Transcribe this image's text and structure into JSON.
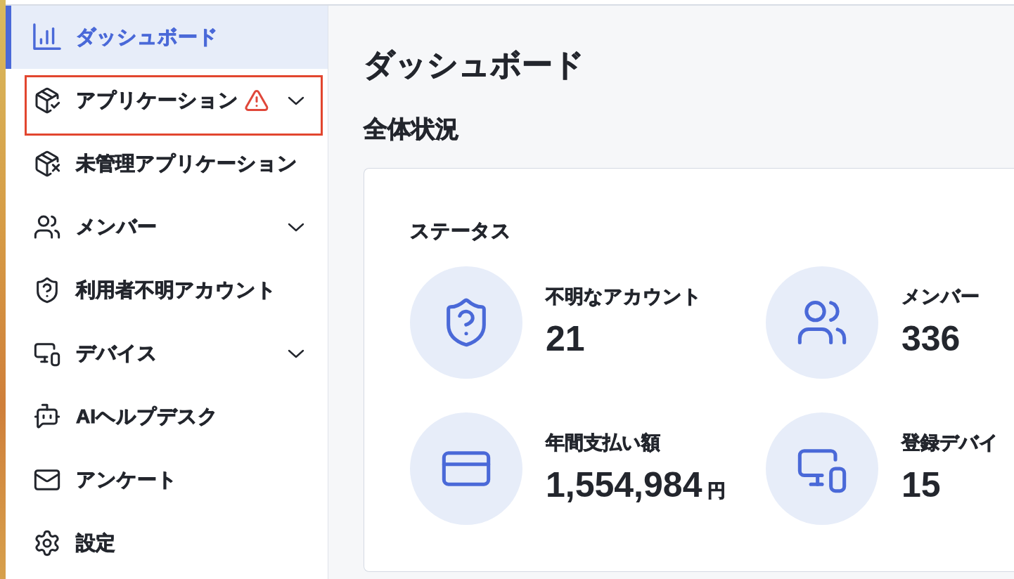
{
  "sidebar": {
    "items": [
      {
        "label": "ダッシュボード",
        "kind": "link",
        "selected": true,
        "warning": false,
        "highlighted": false
      },
      {
        "label": "アプリケーション",
        "kind": "group",
        "selected": false,
        "warning": true,
        "highlighted": true
      },
      {
        "label": "未管理アプリケーション",
        "kind": "link",
        "selected": false,
        "warning": false,
        "highlighted": false
      },
      {
        "label": "メンバー",
        "kind": "group",
        "selected": false,
        "warning": false,
        "highlighted": false
      },
      {
        "label": "利用者不明アカウント",
        "kind": "link",
        "selected": false,
        "warning": false,
        "highlighted": false
      },
      {
        "label": "デバイス",
        "kind": "group",
        "selected": false,
        "warning": false,
        "highlighted": false
      },
      {
        "label": "AIヘルプデスク",
        "kind": "link",
        "selected": false,
        "warning": false,
        "highlighted": false
      },
      {
        "label": "アンケート",
        "kind": "link",
        "selected": false,
        "warning": false,
        "highlighted": false
      },
      {
        "label": "設定",
        "kind": "link",
        "selected": false,
        "warning": false,
        "highlighted": false
      }
    ]
  },
  "main": {
    "title": "ダッシュボード",
    "section_title": "全体状況",
    "status_card": {
      "title": "ステータス",
      "stats": [
        {
          "label": "不明なアカウント",
          "value": "21"
        },
        {
          "label": "メンバー",
          "value": "336"
        },
        {
          "label": "年間支払い額",
          "value": "1,554,984",
          "unit": "円"
        },
        {
          "label": "登録デバイ",
          "value": "15"
        }
      ]
    }
  }
}
